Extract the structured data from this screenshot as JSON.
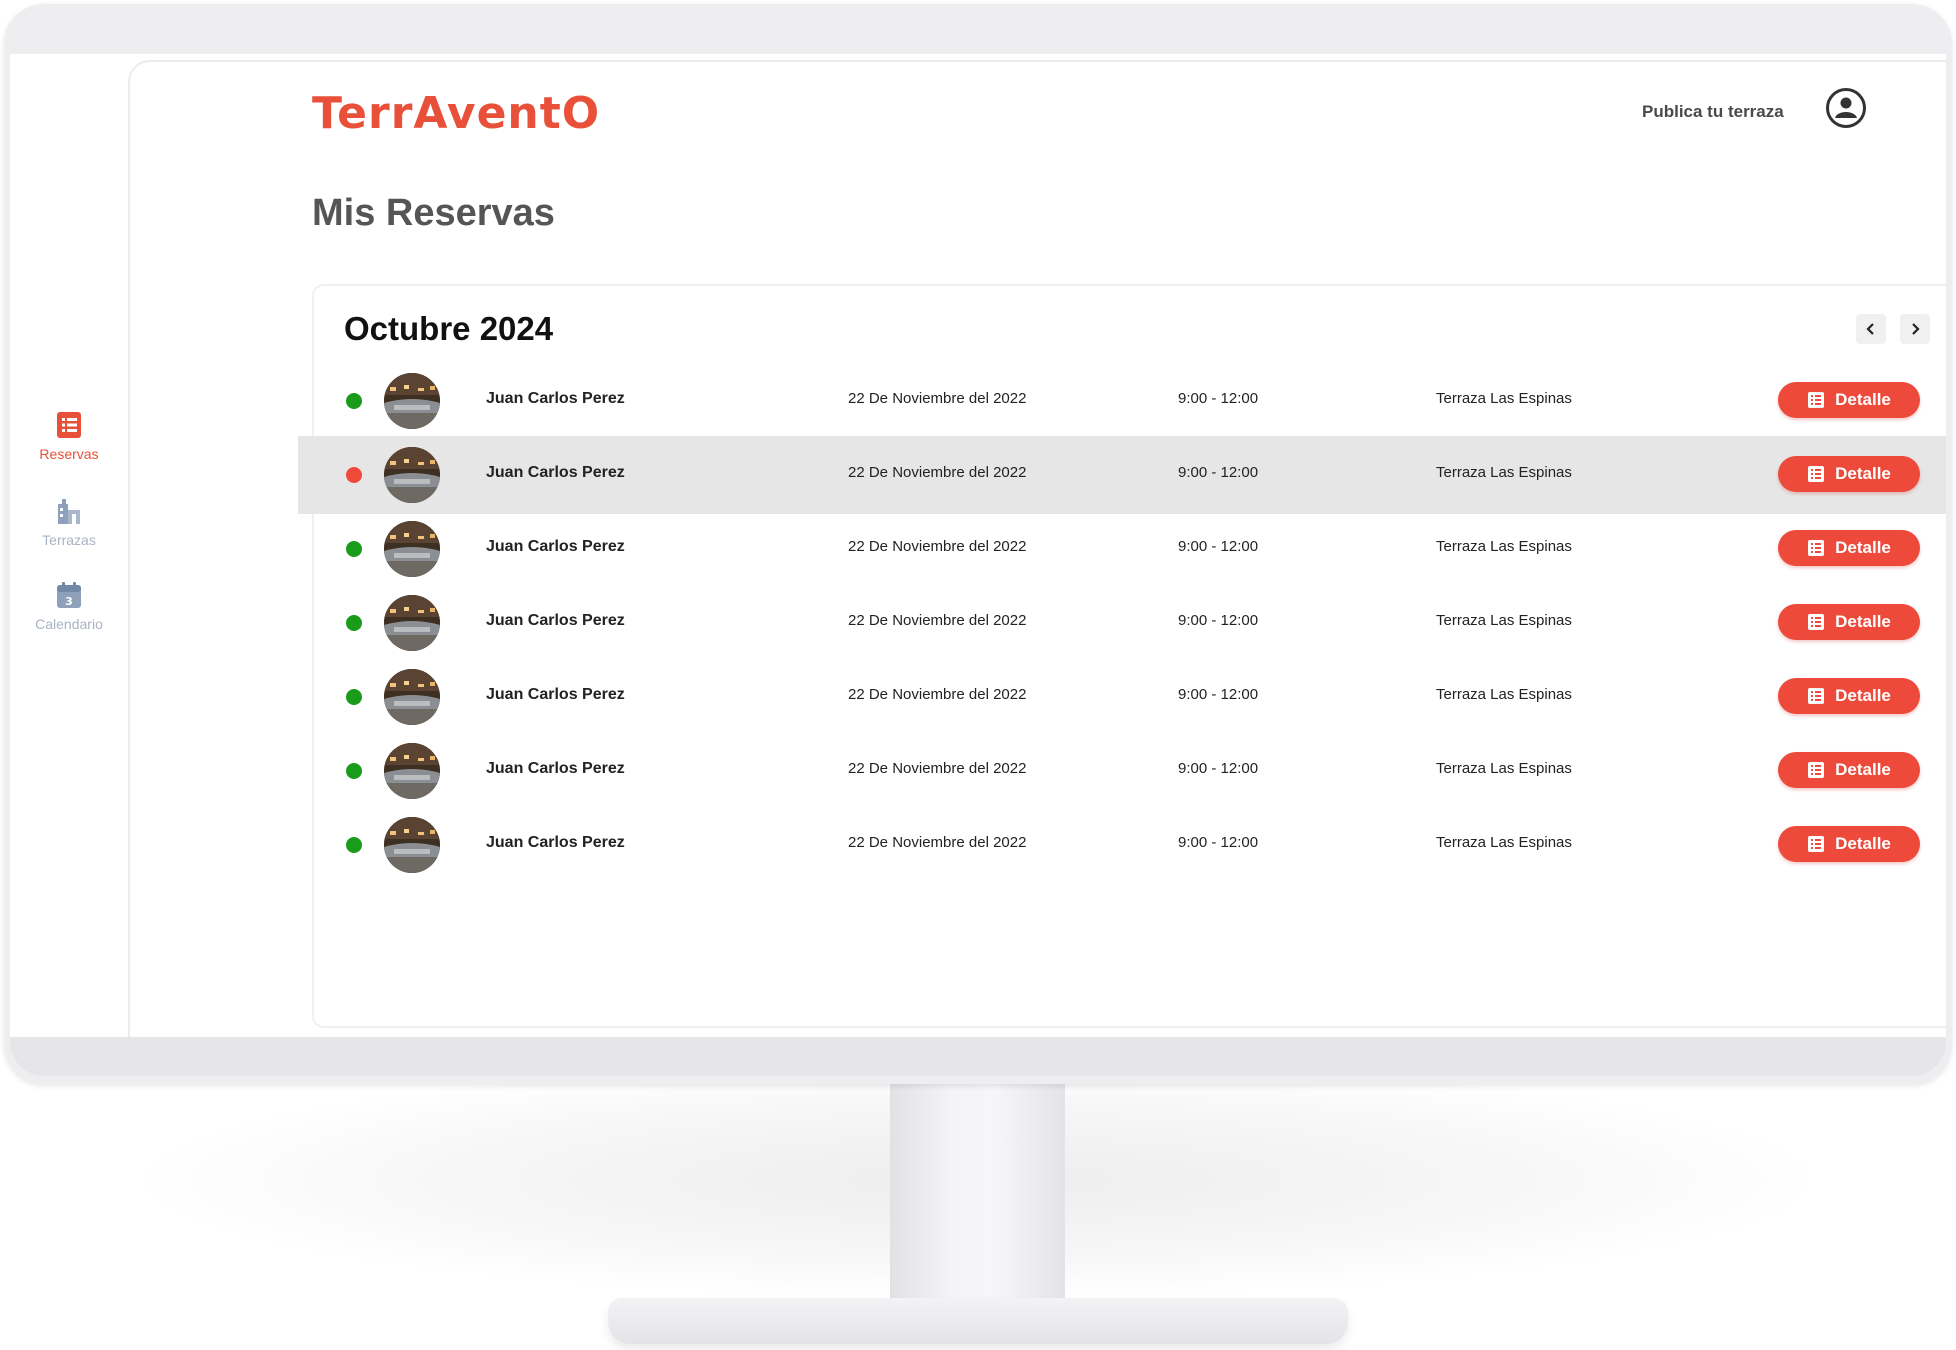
{
  "brand": {
    "logo_text": "TerrAventO",
    "accent": "#e8503a"
  },
  "header": {
    "publish_link": "Publica tu terraza",
    "user_icon": "user-circle-icon"
  },
  "sidebar": {
    "items": [
      {
        "label": "Reservas",
        "icon": "list-icon",
        "active": true
      },
      {
        "label": "Terrazas",
        "icon": "building-icon",
        "active": false
      },
      {
        "label": "Calendario",
        "icon": "calendar-icon",
        "active": false
      }
    ]
  },
  "page": {
    "title": "Mis Reservas"
  },
  "reservations": {
    "month": "Octubre 2024",
    "prev_icon": "chevron-left-icon",
    "next_icon": "chevron-right-icon",
    "rows": [
      {
        "name": "Juan Carlos Perez",
        "date": "22 De Noviembre del 2022",
        "time": "9:00 - 12:00",
        "place": "Terraza Las Espinas",
        "action": "Detalle",
        "status_color": "#1a9c1a",
        "highlight": false
      },
      {
        "name": "Juan Carlos Perez",
        "date": "22 De Noviembre del 2022",
        "time": "9:00 - 12:00",
        "place": "Terraza Las Espinas",
        "action": "Detalle",
        "status_color": "#f04b3a",
        "highlight": true
      },
      {
        "name": "Juan Carlos Perez",
        "date": "22 De Noviembre del 2022",
        "time": "9:00 - 12:00",
        "place": "Terraza Las Espinas",
        "action": "Detalle",
        "status_color": "#1a9c1a",
        "highlight": false
      },
      {
        "name": "Juan Carlos Perez",
        "date": "22 De Noviembre del 2022",
        "time": "9:00 - 12:00",
        "place": "Terraza Las Espinas",
        "action": "Detalle",
        "status_color": "#1a9c1a",
        "highlight": false
      },
      {
        "name": "Juan Carlos Perez",
        "date": "22 De Noviembre del 2022",
        "time": "9:00 - 12:00",
        "place": "Terraza Las Espinas",
        "action": "Detalle",
        "status_color": "#1a9c1a",
        "highlight": false
      },
      {
        "name": "Juan Carlos Perez",
        "date": "22 De Noviembre del 2022",
        "time": "9:00 - 12:00",
        "place": "Terraza Las Espinas",
        "action": "Detalle",
        "status_color": "#1a9c1a",
        "highlight": false
      },
      {
        "name": "Juan Carlos Perez",
        "date": "22 De Noviembre del 2022",
        "time": "9:00 - 12:00",
        "place": "Terraza Las Espinas",
        "action": "Detalle",
        "status_color": "#1a9c1a",
        "highlight": false
      }
    ]
  }
}
